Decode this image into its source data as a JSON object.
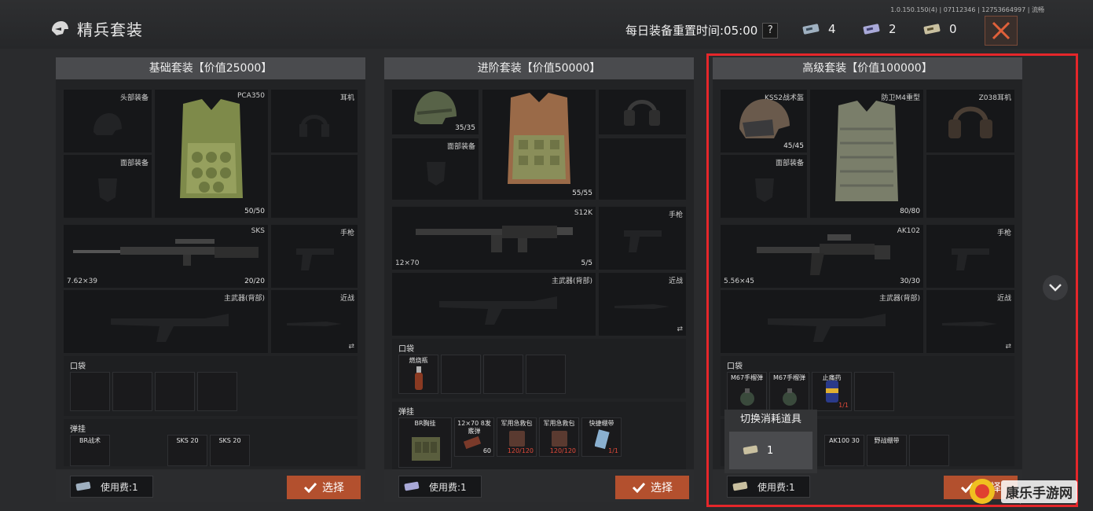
{
  "header": {
    "title": "精兵套装",
    "version": "1.0.150.150(4) | 07112346 | 12753664997 | 流畅",
    "reset_label": "每日装备重置时间:05:00",
    "help": "?",
    "tickets": [
      {
        "icon": "ticket-basic-icon",
        "count": "4"
      },
      {
        "icon": "ticket-advanced-icon",
        "count": "2"
      },
      {
        "icon": "ticket-premium-icon",
        "count": "0"
      }
    ]
  },
  "panels": [
    {
      "title": "基础套装【价值25000】",
      "helmet": "头部装备",
      "face": "面部装备",
      "vest": "PCA350",
      "vest_dur": "50/50",
      "ear": "耳机",
      "rifle": "SKS",
      "rifle_cal": "7.62×39",
      "rifle_dur": "20/20",
      "pistol": "手枪",
      "back": "主武器(背部)",
      "melee": "近战",
      "pocket": "口袋",
      "rig": "弹挂",
      "rig_items": [
        "BR战术",
        "SKS 20",
        "SKS 20"
      ],
      "fee": "使用费:1",
      "select": "选择"
    },
    {
      "title": "进阶套装【价值50000】",
      "helmet_dur": "35/35",
      "face": "面部装备",
      "vest_dur": "55/55",
      "rifle": "S12K",
      "rifle_cal": "12×70",
      "rifle_dur": "5/5",
      "pistol": "手枪",
      "back": "主武器(背部)",
      "melee": "近战",
      "pocket": "口袋",
      "pocket_items": [
        "燃烧瓶"
      ],
      "rig": "弹挂",
      "rig_items": [
        {
          "label": "BR胸挂",
          "val": ""
        },
        {
          "label": "12×70 8发霰弹",
          "val": "60"
        },
        {
          "label": "军用急救包",
          "val": "120/120"
        },
        {
          "label": "军用急救包",
          "val": "120/120"
        },
        {
          "label": "快捷绷带",
          "val": "1/1"
        }
      ],
      "fee": "使用费:1",
      "select": "选择"
    },
    {
      "title": "高级套装【价值100000】",
      "helmet": "KSS2战术盔",
      "helmet_dur": "45/45",
      "face": "面部装备",
      "vest": "防卫M4重型",
      "vest_dur": "80/80",
      "ear": "Z038耳机",
      "rifle": "AK102",
      "rifle_cal": "5.56×45",
      "rifle_dur": "30/30",
      "pistol": "手枪",
      "back": "主武器(背部)",
      "melee": "近战",
      "pocket": "口袋",
      "pocket_items": [
        {
          "label": "M67手榴弹",
          "val": ""
        },
        {
          "label": "M67手榴弹",
          "val": ""
        },
        {
          "label": "止痛药",
          "val": "1/1"
        }
      ],
      "rig_items": [
        "AK100 30",
        "野战绷带"
      ],
      "fee": "使用费:1",
      "select": "选择"
    }
  ],
  "popup": {
    "title": "切换消耗道具",
    "count": "1"
  },
  "watermark": {
    "text": "康乐手游网",
    "url": "chkl-pet.com"
  },
  "colors": {
    "accent": "#b3502e",
    "highlight": "#e5262a",
    "durability_red": "#e24a3a"
  }
}
